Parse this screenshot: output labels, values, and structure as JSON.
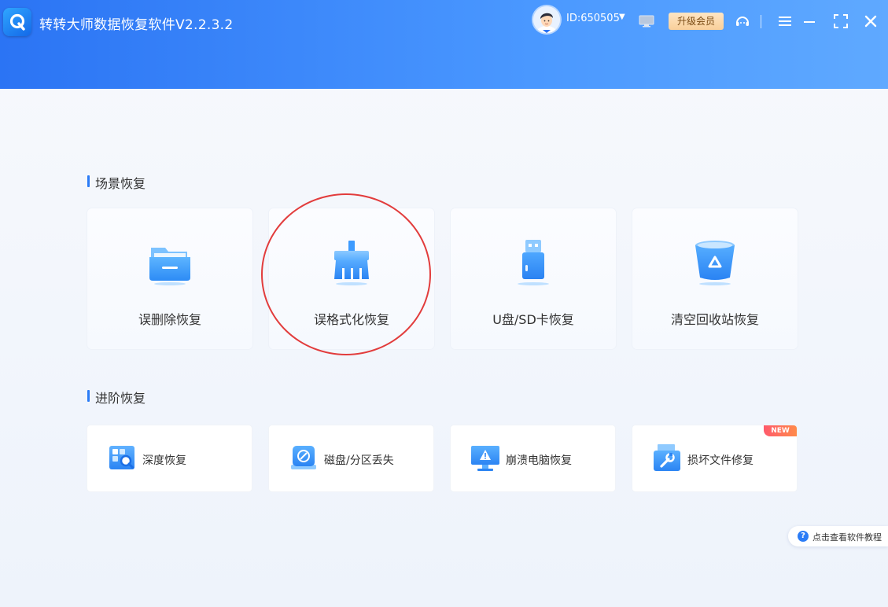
{
  "app": {
    "title": "转转大师数据恢复软件V2.2.3.2"
  },
  "header": {
    "user_id": "ID:650505",
    "vip_label": "升级会员"
  },
  "sections": {
    "scene": {
      "title": "场景恢复"
    },
    "advanced": {
      "title": "进阶恢复"
    }
  },
  "scene_cards": [
    {
      "label": "误删除恢复",
      "icon": "folder-icon"
    },
    {
      "label": "误格式化恢复",
      "icon": "broom-icon"
    },
    {
      "label": "U盘/SD卡恢复",
      "icon": "usb-drive-icon"
    },
    {
      "label": "清空回收站恢复",
      "icon": "recycle-bin-icon"
    }
  ],
  "advanced_cards": [
    {
      "label": "深度恢复",
      "icon": "deep-scan-icon"
    },
    {
      "label": "磁盘/分区丢失",
      "icon": "disk-icon"
    },
    {
      "label": "崩溃电脑恢复",
      "icon": "crashed-computer-icon"
    },
    {
      "label": "损坏文件修复",
      "icon": "file-repair-icon",
      "badge": "NEW"
    }
  ],
  "tutorial": {
    "label": "点击查看软件教程",
    "icon_text": "?"
  },
  "colors": {
    "header_start": "#2b74f4",
    "header_end": "#5fa9ff",
    "accent": "#2b7cf6",
    "highlight_circle": "#e23c3c"
  }
}
